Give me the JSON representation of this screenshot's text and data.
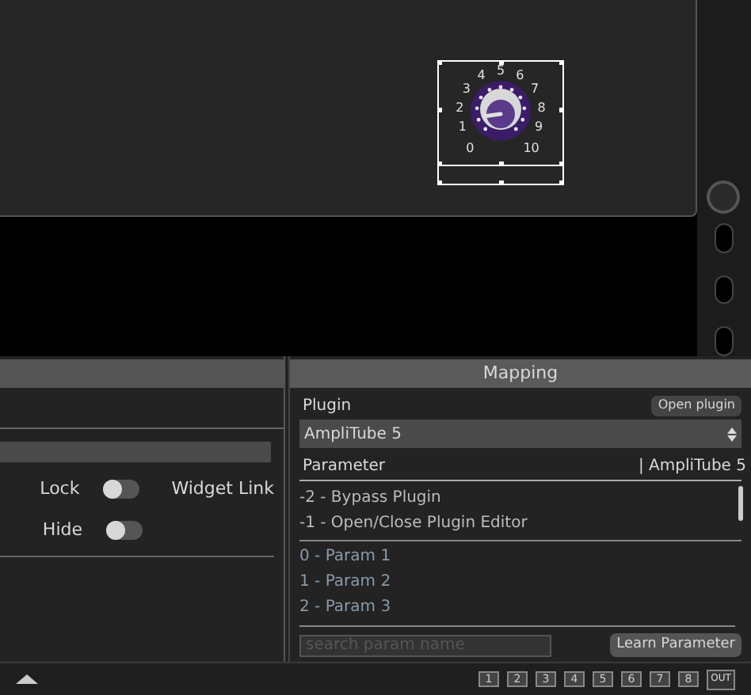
{
  "knob": {
    "scale": [
      "0",
      "1",
      "2",
      "3",
      "4",
      "5",
      "6",
      "7",
      "8",
      "9",
      "10"
    ]
  },
  "left_panel": {
    "toggles": [
      {
        "label": "Lock",
        "on": false
      },
      {
        "label": "Hide",
        "on": false
      }
    ],
    "widget_link": "Widget Link"
  },
  "mapping": {
    "title": "Mapping",
    "plugin_label": "Plugin",
    "open_button": "Open plugin",
    "plugin_select": "AmpliTube 5",
    "parameter_header": "Parameter",
    "plugin_header": "| AmpliTube 5",
    "fixed_params": [
      "-2 - Bypass Plugin",
      "-1 - Open/Close Plugin Editor"
    ],
    "params": [
      "0 - Param 1",
      "1 - Param 2",
      "2 - Param 3"
    ],
    "search": {
      "placeholder": "search param name"
    },
    "learn_button": "Learn Parameter"
  },
  "footer": {
    "outputs": [
      {
        "label": "1",
        "kind": "channel"
      },
      {
        "label": "2",
        "kind": "channel"
      },
      {
        "label": "3",
        "kind": "channel"
      },
      {
        "label": "4",
        "kind": "channel"
      },
      {
        "label": "5",
        "kind": "channel"
      },
      {
        "label": "6",
        "kind": "channel"
      },
      {
        "label": "7",
        "kind": "channel"
      },
      {
        "label": "8",
        "kind": "channel"
      },
      {
        "label": "OUT",
        "kind": "out"
      }
    ]
  }
}
